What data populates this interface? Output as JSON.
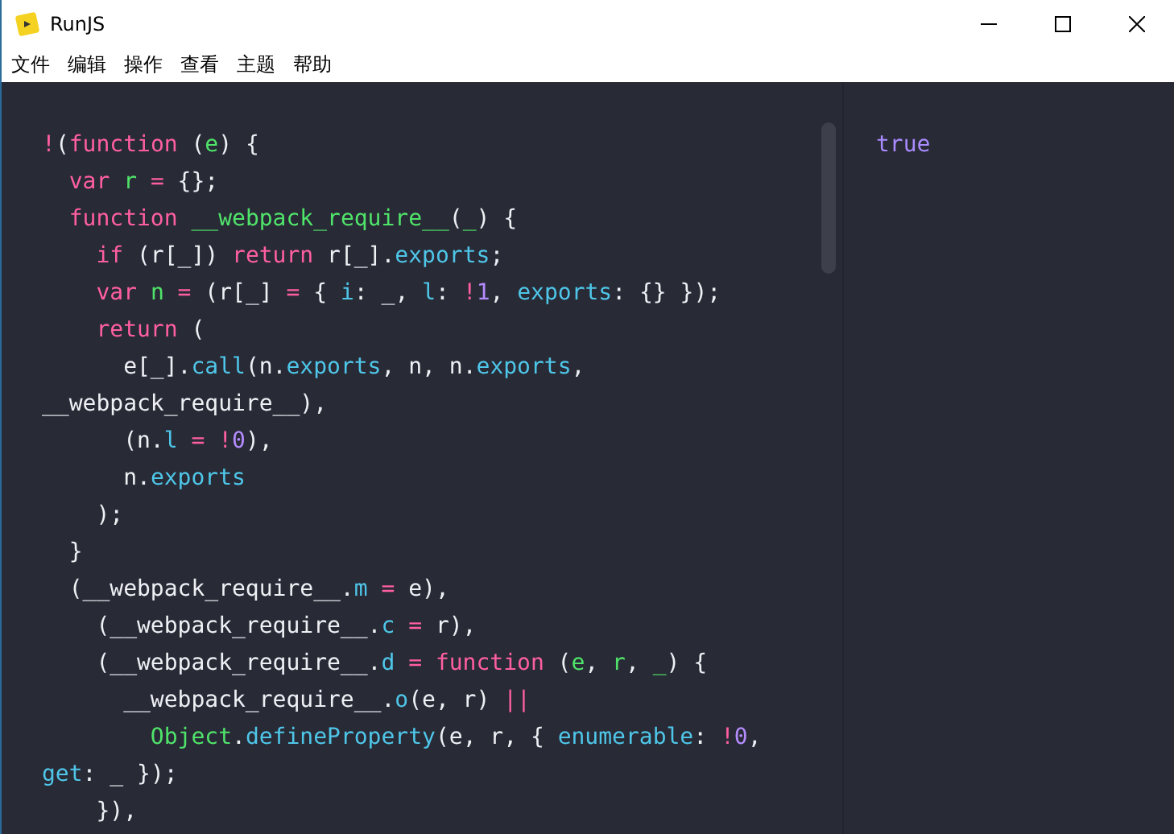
{
  "window": {
    "title": "RunJS"
  },
  "menu": [
    "文件",
    "编辑",
    "操作",
    "查看",
    "主题",
    "帮助"
  ],
  "editor": {
    "lines": [
      [
        {
          "text": "!",
          "kind": "keyword"
        },
        {
          "text": "(",
          "kind": "plain"
        },
        {
          "text": "function",
          "kind": "keyword"
        },
        {
          "text": " (",
          "kind": "plain"
        },
        {
          "text": "e",
          "kind": "variable"
        },
        {
          "text": ") {",
          "kind": "plain"
        }
      ],
      [
        {
          "text": "  var",
          "kind": "keyword"
        },
        {
          "text": " r",
          "kind": "variable"
        },
        {
          "text": " =",
          "kind": "keyword"
        },
        {
          "text": " {};",
          "kind": "plain"
        }
      ],
      [
        {
          "text": "  function",
          "kind": "keyword"
        },
        {
          "text": " __webpack_require__",
          "kind": "variable"
        },
        {
          "text": "(",
          "kind": "plain"
        },
        {
          "text": "_",
          "kind": "variable"
        },
        {
          "text": ") {",
          "kind": "plain"
        }
      ],
      [
        {
          "text": "    if",
          "kind": "keyword"
        },
        {
          "text": " (r[_]) ",
          "kind": "plain"
        },
        {
          "text": "return",
          "kind": "keyword"
        },
        {
          "text": " r[_].",
          "kind": "plain"
        },
        {
          "text": "exports",
          "kind": "property"
        },
        {
          "text": ";",
          "kind": "plain"
        }
      ],
      [
        {
          "text": "    var",
          "kind": "keyword"
        },
        {
          "text": " n",
          "kind": "variable"
        },
        {
          "text": " =",
          "kind": "keyword"
        },
        {
          "text": " (r[_] ",
          "kind": "plain"
        },
        {
          "text": "=",
          "kind": "keyword"
        },
        {
          "text": " { ",
          "kind": "plain"
        },
        {
          "text": "i",
          "kind": "property"
        },
        {
          "text": ": _, ",
          "kind": "plain"
        },
        {
          "text": "l",
          "kind": "property"
        },
        {
          "text": ": ",
          "kind": "plain"
        },
        {
          "text": "!",
          "kind": "keyword"
        },
        {
          "text": "1",
          "kind": "number"
        },
        {
          "text": ", ",
          "kind": "plain"
        },
        {
          "text": "exports",
          "kind": "property"
        },
        {
          "text": ": {} });",
          "kind": "plain"
        }
      ],
      [
        {
          "text": "    return",
          "kind": "keyword"
        },
        {
          "text": " (",
          "kind": "plain"
        }
      ],
      [
        {
          "text": "      e[_].",
          "kind": "plain"
        },
        {
          "text": "call",
          "kind": "property"
        },
        {
          "text": "(n.",
          "kind": "plain"
        },
        {
          "text": "exports",
          "kind": "property"
        },
        {
          "text": ", n, n.",
          "kind": "plain"
        },
        {
          "text": "exports",
          "kind": "property"
        },
        {
          "text": ",",
          "kind": "plain"
        }
      ],
      [
        {
          "text": "__webpack_require__),",
          "kind": "plain"
        }
      ],
      [
        {
          "text": "      (n.",
          "kind": "plain"
        },
        {
          "text": "l",
          "kind": "property"
        },
        {
          "text": " =",
          "kind": "keyword"
        },
        {
          "text": " !",
          "kind": "keyword"
        },
        {
          "text": "0",
          "kind": "number"
        },
        {
          "text": "),",
          "kind": "plain"
        }
      ],
      [
        {
          "text": "      n.",
          "kind": "plain"
        },
        {
          "text": "exports",
          "kind": "property"
        }
      ],
      [
        {
          "text": "    );",
          "kind": "plain"
        }
      ],
      [
        {
          "text": "  }",
          "kind": "plain"
        }
      ],
      [
        {
          "text": "  (__webpack_require__.",
          "kind": "plain"
        },
        {
          "text": "m",
          "kind": "property"
        },
        {
          "text": " =",
          "kind": "keyword"
        },
        {
          "text": " e),",
          "kind": "plain"
        }
      ],
      [
        {
          "text": "    (__webpack_require__.",
          "kind": "plain"
        },
        {
          "text": "c",
          "kind": "property"
        },
        {
          "text": " =",
          "kind": "keyword"
        },
        {
          "text": " r),",
          "kind": "plain"
        }
      ],
      [
        {
          "text": "    (__webpack_require__.",
          "kind": "plain"
        },
        {
          "text": "d",
          "kind": "property"
        },
        {
          "text": " =",
          "kind": "keyword"
        },
        {
          "text": " function",
          "kind": "keyword"
        },
        {
          "text": " (",
          "kind": "plain"
        },
        {
          "text": "e",
          "kind": "variable"
        },
        {
          "text": ", ",
          "kind": "plain"
        },
        {
          "text": "r",
          "kind": "variable"
        },
        {
          "text": ", ",
          "kind": "plain"
        },
        {
          "text": "_",
          "kind": "variable"
        },
        {
          "text": ") {",
          "kind": "plain"
        }
      ],
      [
        {
          "text": "      __webpack_require__.",
          "kind": "plain"
        },
        {
          "text": "o",
          "kind": "property"
        },
        {
          "text": "(e, r) ",
          "kind": "plain"
        },
        {
          "text": "||",
          "kind": "keyword"
        }
      ],
      [
        {
          "text": "        Object",
          "kind": "variable"
        },
        {
          "text": ".",
          "kind": "plain"
        },
        {
          "text": "defineProperty",
          "kind": "property"
        },
        {
          "text": "(e, r, { ",
          "kind": "plain"
        },
        {
          "text": "enumerable",
          "kind": "property"
        },
        {
          "text": ": ",
          "kind": "plain"
        },
        {
          "text": "!",
          "kind": "keyword"
        },
        {
          "text": "0",
          "kind": "number"
        },
        {
          "text": ",",
          "kind": "plain"
        }
      ],
      [
        {
          "text": "get",
          "kind": "property"
        },
        {
          "text": ": _ });",
          "kind": "plain"
        }
      ],
      [
        {
          "text": "    }),",
          "kind": "plain"
        }
      ]
    ]
  },
  "output": {
    "lines": [
      {
        "text": "true",
        "kind": "boolean"
      }
    ]
  }
}
